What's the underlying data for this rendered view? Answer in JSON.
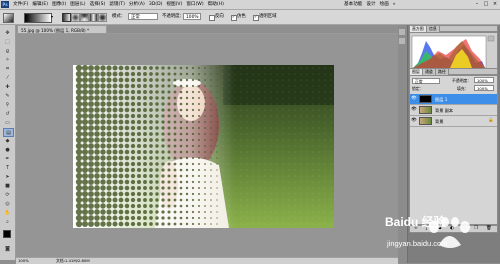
{
  "menubar": {
    "logo": "Ps",
    "menus": [
      "文件(F)",
      "编辑(E)",
      "图像(I)",
      "图层(L)",
      "选择(S)",
      "滤镜(T)",
      "分析(A)",
      "3D(D)",
      "视图(V)",
      "窗口(W)",
      "帮助(H)"
    ],
    "workspaces": [
      "基本功能",
      "设计",
      "绘画",
      "»"
    ],
    "window_buttons": [
      "–",
      "□",
      "×"
    ]
  },
  "options": {
    "mode_label": "模式：",
    "mode_value": "正常",
    "opacity_label": "不透明度：",
    "opacity_value": "100%",
    "reverse_label": "反向",
    "dither_label": "仿色",
    "transparency_label": "透明区域"
  },
  "document": {
    "tab_title": "55.jpg @ 100% (图层 1, RGB/8) *"
  },
  "status": {
    "zoom": "100%",
    "info": "文档:1.41M/2.60M"
  },
  "panels": {
    "histogram_tabs": [
      "直方图",
      "信息"
    ],
    "layers_tabs": [
      "图层",
      "通道",
      "路径"
    ],
    "blend_mode": "正常",
    "opacity_label": "不透明度：",
    "opacity_value": "100%",
    "lock_label": "锁定：",
    "fill_label": "填充：",
    "fill_value": "100%",
    "layers": [
      {
        "name": "图层 1"
      },
      {
        "name": "背景 副本"
      },
      {
        "name": "背景"
      }
    ]
  },
  "watermark": {
    "brand": "Baidu 经验",
    "url": "jingyan.baidu.com"
  },
  "colors": {
    "selected_layer": "#3d8ee8",
    "foreground": "#000000",
    "background": "#ffffff",
    "ps_blue": "#1f3e78"
  }
}
